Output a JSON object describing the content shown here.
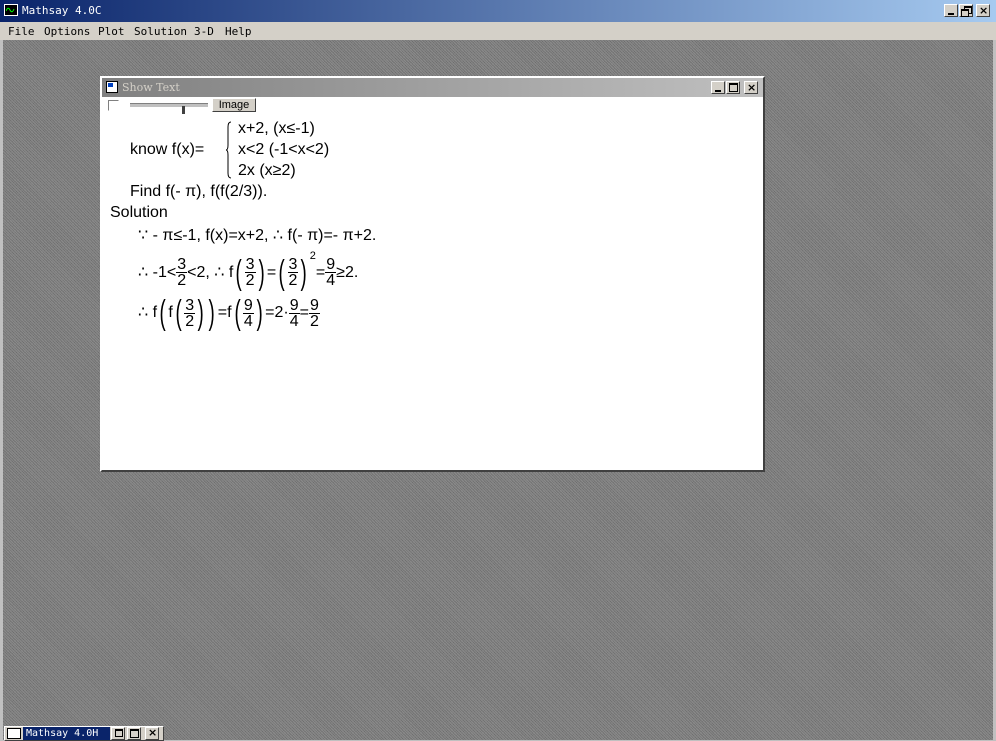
{
  "window": {
    "title": "Mathsay 4.0C",
    "controls": [
      "minimize",
      "restore",
      "close"
    ]
  },
  "menu": {
    "items": [
      "File",
      "Options",
      "Plot",
      "Solution",
      "3-D",
      "Help"
    ]
  },
  "show_text_window": {
    "title": "Show Text",
    "toolbar": {
      "image_button": "Image",
      "checkbox_checked": false,
      "slider_value": 0.33
    },
    "content": {
      "line1_prefix": "know  f(x)=",
      "case1": "x+2, (x≤-1)",
      "case2": "x<2 (-1<x<2)",
      "case3": "2x (x≥2)",
      "line2": "Find f(- π), f(f(2/3)).",
      "solution_label": "Solution",
      "step1": "∵ - π≤-1,  f(x)=x+2, ∴ f(- π)=- π+2.",
      "step2_prefix": "∴ -1<",
      "step2_mid": "<2, ∴ f",
      "step2_eq": "=",
      "step2_exp": "2",
      "step2_eq2": "=",
      "step2_tail": "≥2.",
      "step3_prefix": "∴ f",
      "step3_mid": "=f",
      "step3_eq": "=2·",
      "step3_eq2": "=",
      "frac_3_2": {
        "num": "3",
        "den": "2"
      },
      "frac_9_4": {
        "num": "9",
        "den": "4"
      },
      "frac_9_2": {
        "num": "9",
        "den": "2"
      }
    }
  },
  "taskbar": {
    "item_label": "Mathsay 4.0H"
  }
}
